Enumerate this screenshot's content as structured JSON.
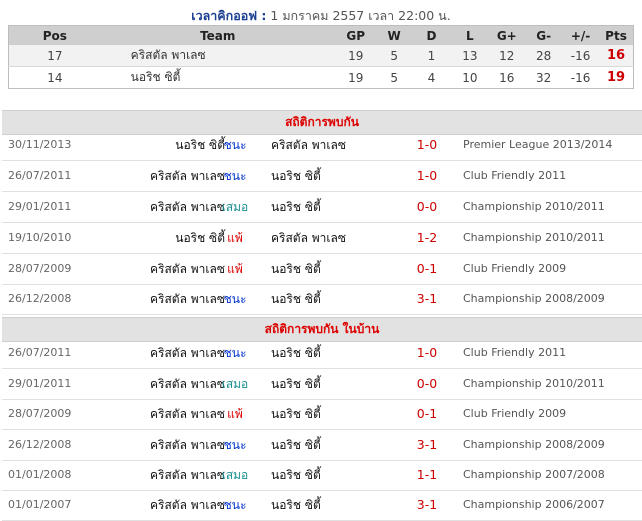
{
  "kickoff": {
    "label": "เวลาคิกออฟ :",
    "value": " 1 มกราคม 2557 เวลา 22:00 น."
  },
  "standings": {
    "headers": [
      "Pos",
      "Team",
      "GP",
      "W",
      "D",
      "L",
      "G+",
      "G-",
      "+/-",
      "Pts"
    ],
    "rows": [
      [
        "17",
        "คริสตัล พาเลซ",
        "19",
        "5",
        "1",
        "13",
        "12",
        "28",
        "-16",
        "16"
      ],
      [
        "14",
        "นอริช ซิตี้",
        "19",
        "5",
        "4",
        "10",
        "16",
        "32",
        "-16",
        "19"
      ]
    ]
  },
  "h2h": {
    "title": "สถิติการพบกัน",
    "matches": [
      {
        "date": "30/11/2013",
        "home": "นอริช ซิตี้",
        "result": "ชนะ",
        "type": "win",
        "away": "คริสตัล พาเลซ",
        "score": "1-0",
        "competition": "Premier League 2013/2014"
      },
      {
        "date": "26/07/2011",
        "home": "คริสตัล พาเลซ",
        "result": "ชนะ",
        "type": "win",
        "away": "นอริช ซิตี้",
        "score": "1-0",
        "competition": "Club Friendly 2011"
      },
      {
        "date": "29/01/2011",
        "home": "คริสตัล พาเลซ",
        "result": "เสมอ",
        "type": "draw",
        "away": "นอริช ซิตี้",
        "score": "0-0",
        "competition": "Championship 2010/2011"
      },
      {
        "date": "19/10/2010",
        "home": "นอริช ซิตี้",
        "result": "แพ้",
        "type": "loss",
        "away": "คริสตัล พาเลซ",
        "score": "1-2",
        "competition": "Championship 2010/2011"
      },
      {
        "date": "28/07/2009",
        "home": "คริสตัล พาเลซ",
        "result": "แพ้",
        "type": "loss",
        "away": "นอริช ซิตี้",
        "score": "0-1",
        "competition": "Club Friendly 2009"
      },
      {
        "date": "26/12/2008",
        "home": "คริสตัล พาเลซ",
        "result": "ชนะ",
        "type": "win",
        "away": "นอริช ซิตี้",
        "score": "3-1",
        "competition": "Championship 2008/2009"
      }
    ]
  },
  "home_h2h": {
    "title": "สถิติการพบกัน ในบ้าน",
    "matches": [
      {
        "date": "26/07/2011",
        "home": "คริสตัล พาเลซ",
        "result": "ชนะ",
        "type": "win",
        "away": "นอริช ซิตี้",
        "score": "1-0",
        "competition": "Club Friendly 2011"
      },
      {
        "date": "29/01/2011",
        "home": "คริสตัล พาเลซ",
        "result": "เสมอ",
        "type": "draw",
        "away": "นอริช ซิตี้",
        "score": "0-0",
        "competition": "Championship 2010/2011"
      },
      {
        "date": "28/07/2009",
        "home": "คริสตัล พาเลซ",
        "result": "แพ้",
        "type": "loss",
        "away": "นอริช ซิตี้",
        "score": "0-1",
        "competition": "Club Friendly 2009"
      },
      {
        "date": "26/12/2008",
        "home": "คริสตัล พาเลซ",
        "result": "ชนะ",
        "type": "win",
        "away": "นอริช ซิตี้",
        "score": "3-1",
        "competition": "Championship 2008/2009"
      },
      {
        "date": "01/01/2008",
        "home": "คริสตัล พาเลซ",
        "result": "เสมอ",
        "type": "draw",
        "away": "นอริช ซิตี้",
        "score": "1-1",
        "competition": "Championship 2007/2008"
      },
      {
        "date": "01/01/2007",
        "home": "คริสตัล พาเลซ",
        "result": "ชนะ",
        "type": "win",
        "away": "นอริช ซิตี้",
        "score": "3-1",
        "competition": "Championship 2006/2007"
      }
    ]
  }
}
